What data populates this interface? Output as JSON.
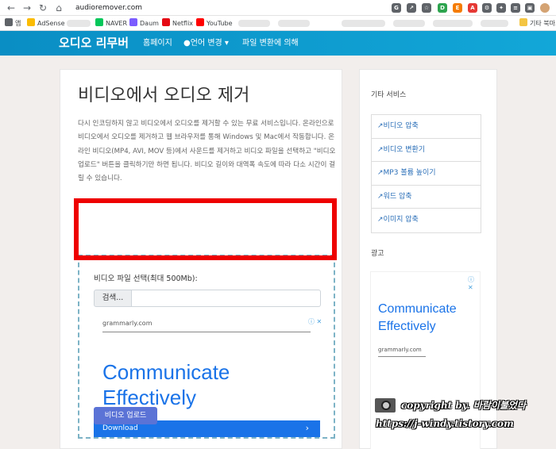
{
  "browser": {
    "url": "audioremover.com",
    "bookmarks": [
      {
        "label": "앱",
        "color": "#5f6368"
      },
      {
        "label": "AdSense",
        "color": "#fbbc04"
      },
      {
        "label": "NAVER",
        "color": "#03c75a"
      },
      {
        "label": "Daum",
        "color": "#7b5cff"
      },
      {
        "label": "Netflix",
        "color": "#e50914"
      },
      {
        "label": "YouTube",
        "color": "#ff0000"
      }
    ],
    "other_bookmarks": "기타 북마크"
  },
  "nav": {
    "brand": "오디오 리무버",
    "links": [
      "홈페이지",
      "언어 변경",
      "파일 변환에 의해"
    ]
  },
  "main": {
    "title": "비디오에서 오디오 제거",
    "description": "다시 인코딩하지 않고 비디오에서 오디오를 제거할 수 있는 무료 서비스입니다. 온라인으로 비디오에서 오디오를 제거하고 웹 브라우저를 통해 Windows 및 Mac에서 작동합니다. 온라인 비디오(MP4, AVI, MOV 등)에서 사운드를 제거하고 비디오 파일을 선택하고 \"비디오 업로드\" 버튼을 클릭하기만 하면 됩니다. 비디오 길이와 대역폭 속도에 따라 다소 시간이 걸릴 수 있습니다.",
    "upload_label": "비디오 파일 선택(최대 500Mb):",
    "browse_label": "검색...",
    "upload_button": "비디오 업로드"
  },
  "ad": {
    "domain": "grammarly.com",
    "headline": "Communicate Effectively",
    "cta": "Download"
  },
  "sidebar": {
    "other_services_heading": "기타 서비스",
    "services": [
      "비디오 압축",
      "비디오 변환기",
      "MP3 볼륨 높이기",
      "워드 압축",
      "이미지 압축"
    ],
    "ad_heading": "광고",
    "ad_headline": "Communicate Effectively",
    "ad_domain": "grammarly.com"
  },
  "watermark": {
    "line1": "copyright by. 바람이불었다",
    "line2": "https://j-windy.tistory.com"
  }
}
